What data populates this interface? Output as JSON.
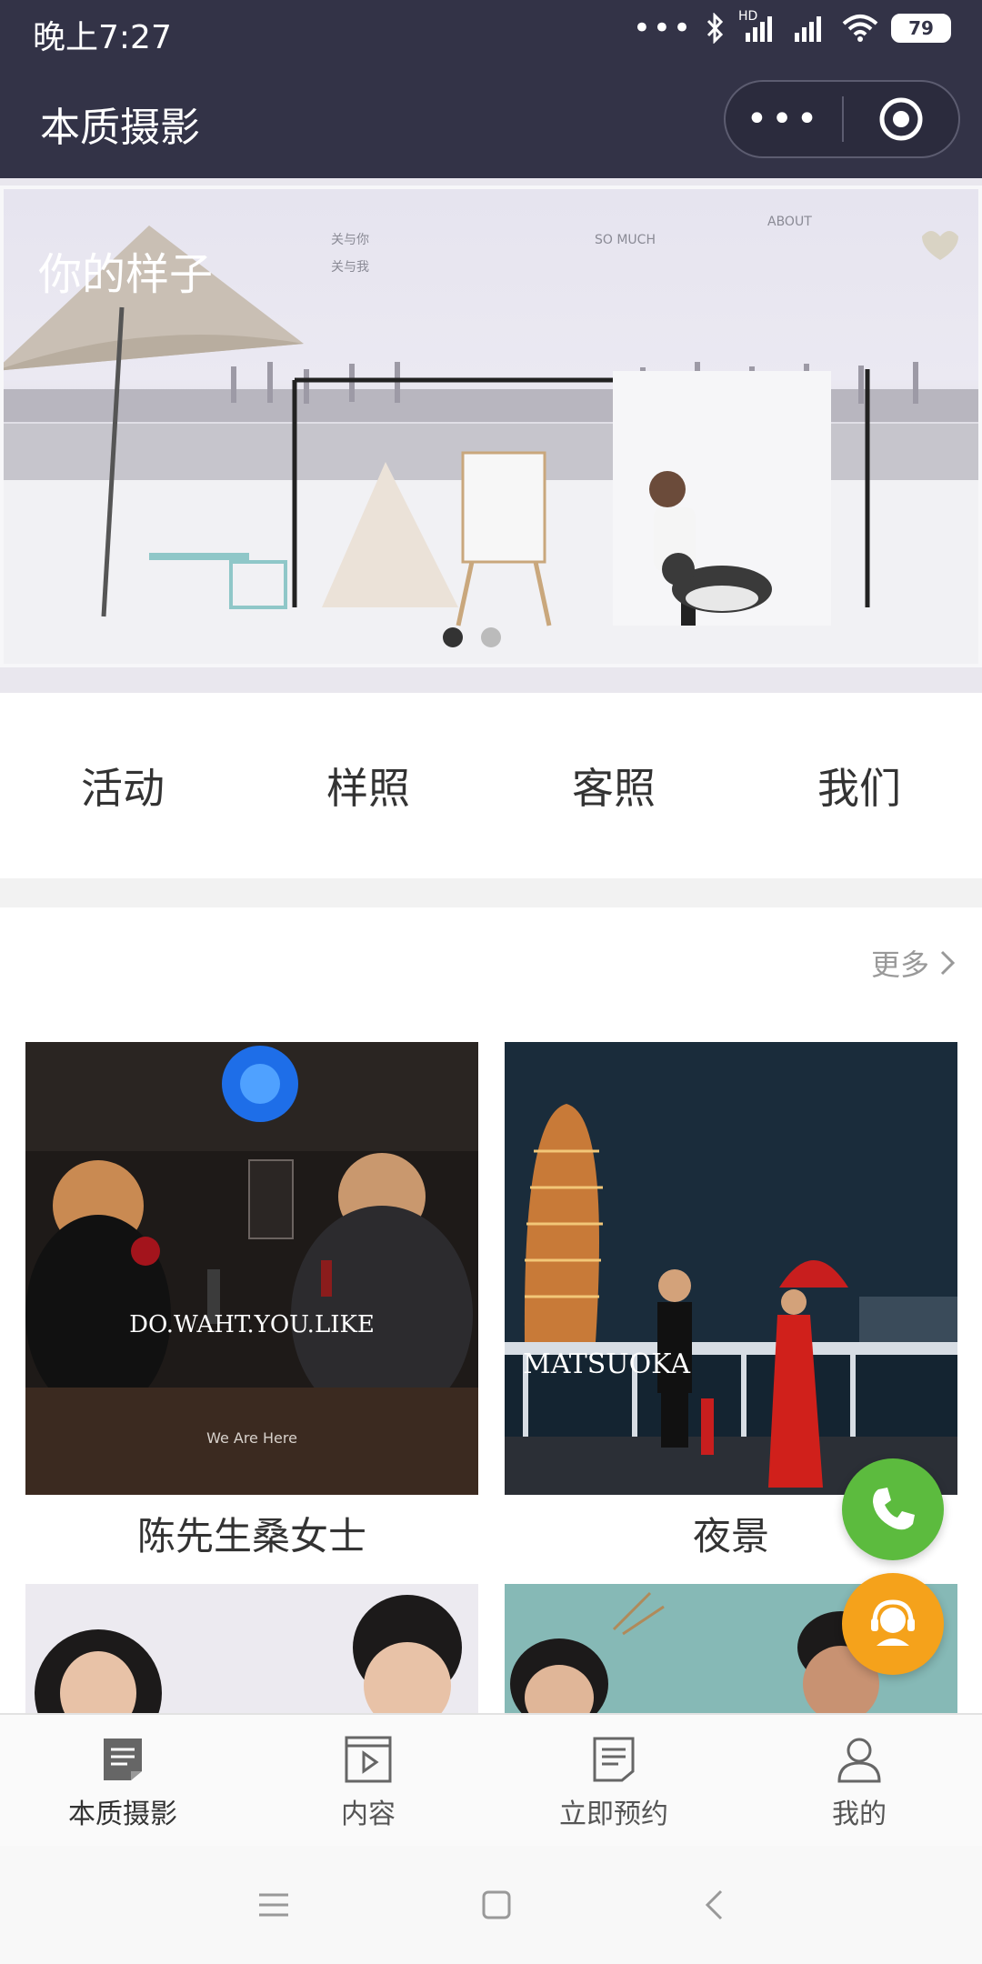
{
  "status_bar": {
    "time": "晚上7:27",
    "dots": "•••",
    "network": "HD",
    "battery": "79"
  },
  "title_bar": {
    "title": "本质摄影",
    "more_glyph": "•••"
  },
  "banner": {
    "overlay_text": [
      "你的样子",
      "关与你",
      "关与我",
      "SO MUCH",
      "ABOUT"
    ],
    "active_slide": 1,
    "slide_count": 2
  },
  "nav": {
    "items": [
      "活动",
      "样照",
      "客照",
      "我们"
    ]
  },
  "section": {
    "more_label": "更多"
  },
  "cards": [
    {
      "caption": "陈先生桑女士",
      "photo_text": "DO.WAHT.YOU.LIKE",
      "photo_text_sub": "We Are Here"
    },
    {
      "caption": "夜景",
      "photo_text": "MATSUOKA"
    },
    {
      "caption": ""
    },
    {
      "caption": ""
    }
  ],
  "tabbar": {
    "items": [
      {
        "label": "本质摄影",
        "icon": "document-icon",
        "active": true
      },
      {
        "label": "内容",
        "icon": "play-icon",
        "active": false
      },
      {
        "label": "立即预约",
        "icon": "note-icon",
        "active": false
      },
      {
        "label": "我的",
        "icon": "user-icon",
        "active": false
      }
    ]
  },
  "system_nav": {
    "menu": "menu-icon",
    "home": "home-icon",
    "back": "back-icon"
  },
  "colors": {
    "title_bar_bg": "#333347",
    "phone_fab": "#5cbb3e",
    "service_fab": "#f5a21b"
  }
}
